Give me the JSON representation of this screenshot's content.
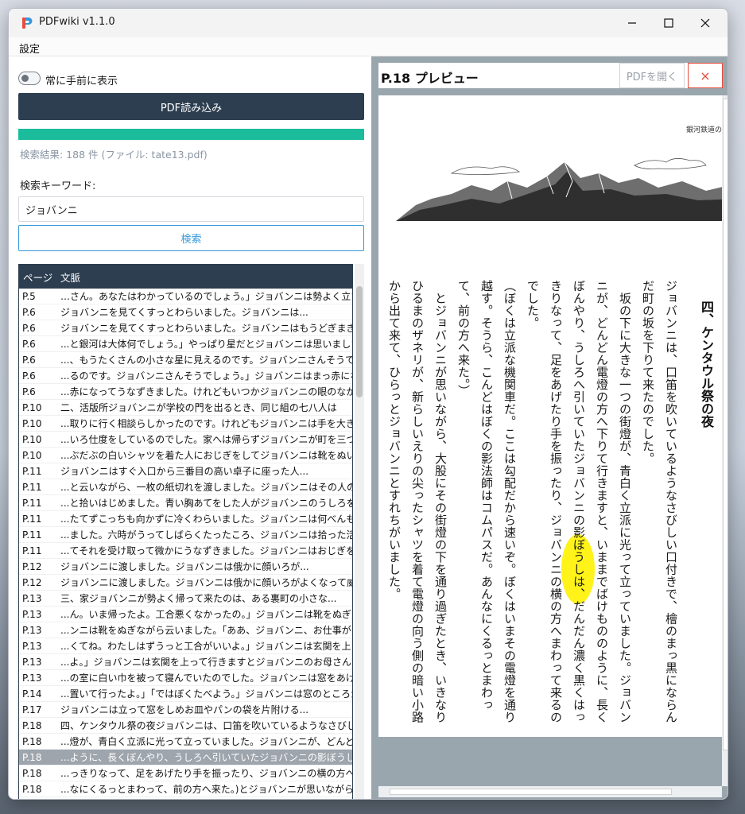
{
  "window": {
    "title": "PDFwiki v1.1.0"
  },
  "menu": {
    "settings": "設定"
  },
  "controls": {
    "always_on_top_label": "常に手前に表示",
    "load_pdf_label": "PDF読み込み",
    "progress_percent": 100,
    "result_summary": "検索結果: 188 件 (ファイル: tate13.pdf)",
    "keyword_label": "検索キーワード:",
    "keyword_value": "ジョバンニ",
    "search_label": "検索"
  },
  "table": {
    "headers": {
      "page": "ページ",
      "context": "文脈"
    },
    "selected_index": 29,
    "rows": [
      {
        "page": "P.5",
        "context": "…さん。あなたはわかっているのでしょう。」ジョバンニは勢よく立ちあ"
      },
      {
        "page": "P.6",
        "context": "ジョバンニを見てくすっとわらいました。ジョバンニは..."
      },
      {
        "page": "P.6",
        "context": "ジョバンニを見てくすっとわらいました。ジョバンニはもうどぎまぎしてま"
      },
      {
        "page": "P.6",
        "context": "...と銀河は大体何でしょう。」やっぱり星だとジョバンニは思いました"
      },
      {
        "page": "P.6",
        "context": "...、もうたくさんの小さな星に見えるのです。ジョバンニさんそうでしょ"
      },
      {
        "page": "P.6",
        "context": "...るのです。ジョバンニさんそうでしょう。」ジョバンニはまっ赤になって"
      },
      {
        "page": "P.6",
        "context": "...赤になってうなずきました。けれどもいつかジョバンニの眼のなかに"
      },
      {
        "page": "P.10",
        "context": "二、活版所ジョバンニが学校の門を出るとき、同じ組の七八人は"
      },
      {
        "page": "P.10",
        "context": "...取りに行く相談らしかったのです。けれどもジョバンニは手を大きく"
      },
      {
        "page": "P.10",
        "context": "...いろ仕度をしているのでした。家へは帰らずジョバンニが町を三つ"
      },
      {
        "page": "P.10",
        "context": "...ぶだぶの白いシャツを着た人におじぎをしてジョバンニは靴をぬいで"
      },
      {
        "page": "P.11",
        "context": "ジョバンニはすぐ入口から三番目の高い卓子に座った人..."
      },
      {
        "page": "P.11",
        "context": "...と云いながら、一枚の紙切れを渡しました。ジョバンニはその人の"
      },
      {
        "page": "P.11",
        "context": "...と拾いはじめました。青い胸あてをした人がジョバンニのうしろを通"
      },
      {
        "page": "P.11",
        "context": "...たてずこっちも向かずに冷くわらいました。ジョバンニは何べんも眼"
      },
      {
        "page": "P.11",
        "context": "...ました。六時がうってしばらくたったころ、ジョバンニは拾った活字を"
      },
      {
        "page": "P.11",
        "context": "...てそれを受け取って微かにうなずきました。ジョバンニはおじぎをすると"
      },
      {
        "page": "P.12",
        "context": "ジョバンニに渡しました。ジョバンニは俄かに顔いろが..."
      },
      {
        "page": "P.12",
        "context": "ジョバンニに渡しました。ジョバンニは俄かに顔いろがよくなって威勢"
      },
      {
        "page": "P.13",
        "context": "三、家ジョバンニが勢よく帰って来たのは、ある裏町の小さな..."
      },
      {
        "page": "P.13",
        "context": "...ん。いま帰ったよ。工合悪くなかったの。」ジョバンニは靴をぬぎな"
      },
      {
        "page": "P.13",
        "context": "...ンニは靴をぬぎながら云いました。「ああ、ジョバンニ、お仕事がひ"
      },
      {
        "page": "P.13",
        "context": "...くてね。わたしはずうっと工合がいいよ。」ジョバンニは玄関を上って"
      },
      {
        "page": "P.13",
        "context": "...よ。」ジョバンニは玄関を上って行きますとジョバンニのお母さんが"
      },
      {
        "page": "P.13",
        "context": "...の室に白い巾を被って寝んでいたのでした。ジョバンニは窓をあけ"
      },
      {
        "page": "P.14",
        "context": "...置いて行ったよ。」「ではぼくたべよう。」ジョバンニは窓のところから"
      },
      {
        "page": "P.17",
        "context": "ジョバンニは立って窓をしめお皿やパンの袋を片附ける..."
      },
      {
        "page": "P.18",
        "context": "四、ケンタウル祭の夜ジョバンニは、口笛を吹いているようなさびしい"
      },
      {
        "page": "P.18",
        "context": "...燈が、青白く立派に光って立っていました。ジョバンニが、どんどん"
      },
      {
        "page": "P.18",
        "context": "...ように、長くぼんやり、うしろへ引いていたジョバンニの影ぼうしは、"
      },
      {
        "page": "P.18",
        "context": "...っきりなって、足をあげたり手を振ったり、ジョバンニの横の方へまわ"
      },
      {
        "page": "P.18",
        "context": "...なにくるっとまわって、前の方へ来た。)とジョバンニが思いながら、"
      }
    ]
  },
  "preview": {
    "title": "P.18 プレビュー",
    "open_pdf_label": "PDFを開く",
    "close_label": "×",
    "running_head": "銀河鉄道の",
    "chapter_title": "四、ケンタウル祭の夜",
    "highlight_word": "ジョバンニ",
    "body_text": "ジョバンニは、口笛を吹いているようなさびしい口付きで、檜のまっ黒にならんだ町の坂を下りて来たのでした。\n　坂の下に大きな一つの街燈が、青白く立派に光って立っていました。ジョバンニが、どんどん電燈の方へ下りて行きますと、いままでばけもののように、長くぼんやり、うしろへ引いていたジョバンニの影ぼうしは、だんだん濃く黒くはっきりなって、足をあげたり手を振ったり、ジョバンニの横の方へまわって来るのでした。\n（ぼくは立派な機関車だ。ここは勾配だから速いぞ。ぼくはいまその電燈を通り越す。そうら、こんどはぼくの影法師はコムパスだ。あんなにくるっとまわって、前の方へ来た。）\n　とジョバンニが思いながら、大股にその街燈の下を通り過ぎたとき、いきなりひるまのザネリが、新らしいえりの尖ったシャツを着て電燈の向う側の暗い小路から出て来て、ひらっとジョバンニとすれちがいました。"
  },
  "colors": {
    "primary_dark": "#2c3e50",
    "progress": "#1abc9c",
    "search_accent": "#3498db",
    "close_accent": "#e74c3c",
    "highlight": "#fff200"
  }
}
